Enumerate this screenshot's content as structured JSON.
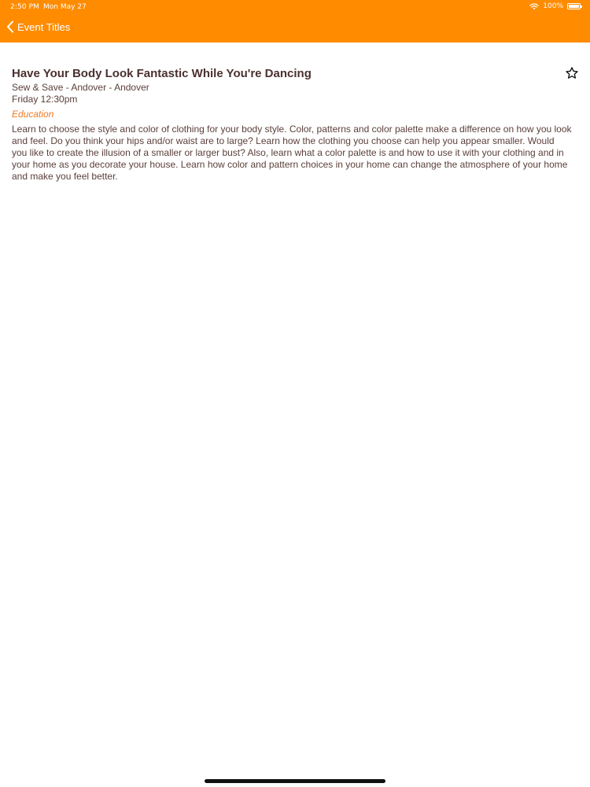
{
  "status_bar": {
    "time": "2:50 PM",
    "date": "Mon May 27",
    "battery": "100%"
  },
  "nav": {
    "back_label": "Event Titles"
  },
  "event": {
    "title": "Have Your Body Look Fantastic While You're Dancing",
    "location": "Sew & Save - Andover - Andover",
    "time": "Friday 12:30pm",
    "category": "Education",
    "description": "Learn to choose the style and color of clothing for your body style.  Color, patterns and color palette make a difference on how you look and feel. Do you think your hips and/or waist are to large? Learn how the clothing you choose can help you appear smaller. Would you like to create the illusion of a smaller or larger bust?  Also, learn what a color palette is and how to use it with your clothing and in your home as you decorate your house. Learn how color and pattern choices in your home can change the atmosphere of your home and make you feel better."
  },
  "colors": {
    "accent": "#ff8c00",
    "category": "#f07a24",
    "text": "#5a3f3a"
  },
  "icons": {
    "back": "chevron-left-icon",
    "favorite": "star-outline-icon",
    "wifi": "wifi-icon",
    "battery": "battery-icon"
  }
}
